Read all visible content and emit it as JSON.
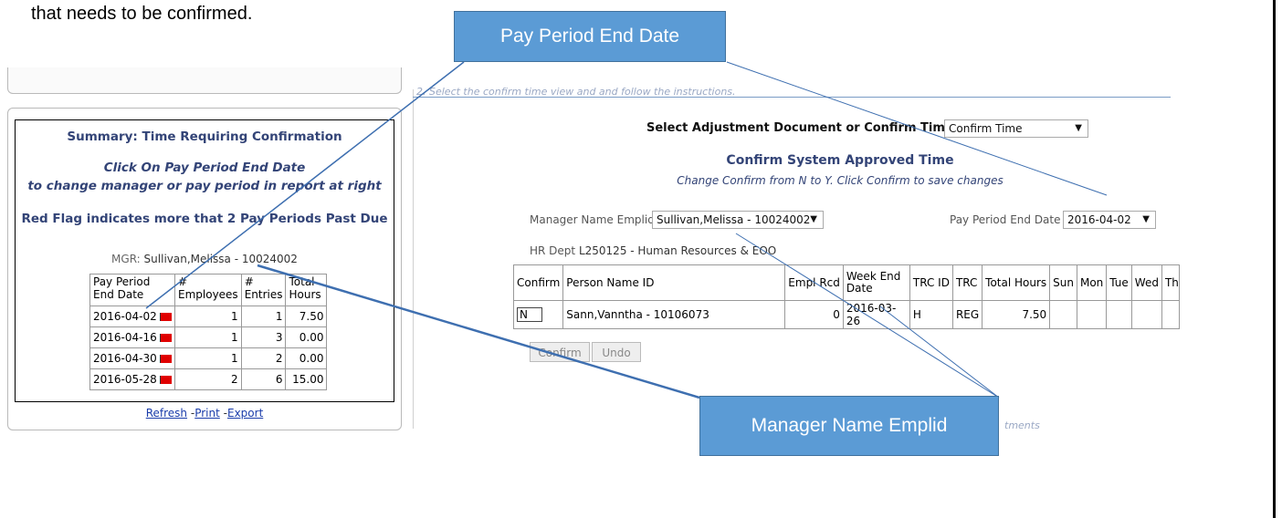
{
  "doc": {
    "text": "that needs to be confirmed."
  },
  "callouts": {
    "pay_period": "Pay Period End Date",
    "manager": "Manager Name Emplid"
  },
  "summary": {
    "title": "Summary: Time Requiring Confirmation",
    "instruction_line1": "Click On Pay Period End Date",
    "instruction_line2": "to change manager or pay period in report at right",
    "flag_note": "Red Flag indicates more that 2 Pay Periods Past Due",
    "mgr_label": "MGR:",
    "mgr_value": "Sullivan,Melissa - 10024002",
    "columns": [
      "Pay Period End Date",
      "# Employees",
      "# Entries",
      "Total Hours"
    ],
    "rows": [
      {
        "date": "2016-04-02",
        "employees": "1",
        "entries": "1",
        "hours": "7.50"
      },
      {
        "date": "2016-04-16",
        "employees": "1",
        "entries": "3",
        "hours": "0.00"
      },
      {
        "date": "2016-04-30",
        "employees": "1",
        "entries": "2",
        "hours": "0.00"
      },
      {
        "date": "2016-05-28",
        "employees": "2",
        "entries": "6",
        "hours": "15.00"
      }
    ],
    "links": {
      "refresh": "Refresh",
      "print": "Print",
      "export": "Export",
      "sep": "-"
    }
  },
  "main": {
    "faint_instruction": "2. Select the confirm time view and and follow the instructions.",
    "select_label": "Select Adjustment Document or Confirm Time",
    "select_value": "Confirm Time",
    "title": "Confirm System Approved Time",
    "subtitle": "Change Confirm from N to Y. Click Confirm to save changes",
    "mgr_label": "Manager Name Emplid",
    "mgr_value": "Sullivan,Melissa - 10024002",
    "ppe_label": "Pay Period End Date",
    "ppe_value": "2016-04-02",
    "hr_label": "HR Dept",
    "hr_value": "L250125 - Human Resources & EOO",
    "columns": [
      "Confirm",
      "Person Name ID",
      "Empl Rcd",
      "Week End Date",
      "TRC ID",
      "TRC",
      "Total Hours",
      "Sun",
      "Mon",
      "Tue",
      "Wed",
      "Thu"
    ],
    "row": {
      "confirm": "N",
      "person": "Sann,Vanntha - 10106073",
      "empl_rcd": "0",
      "week_end": "2016-03-26",
      "trc_id": "H",
      "trc": "REG",
      "total_hours": "7.50"
    },
    "confirm_button": "Confirm",
    "undo_button": "Undo",
    "faint_bottom": "tments"
  },
  "colors": {
    "callout_fill": "#5b9bd5",
    "flag_red": "#e00000",
    "heading_blue": "#334477"
  }
}
